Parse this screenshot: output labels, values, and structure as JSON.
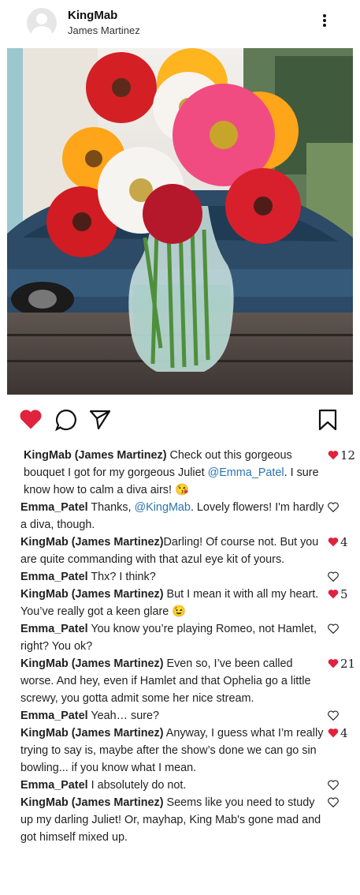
{
  "post": {
    "account_name": "KingMab",
    "real_name": "James Martinez"
  },
  "icons": {
    "avatar": "default-avatar-icon",
    "more": "more-vertical-icon",
    "like": "heart-icon",
    "comment": "comment-icon",
    "share": "send-icon",
    "save": "bookmark-icon"
  },
  "colors": {
    "like_red": "#e0223c",
    "mention_blue": "#2a74b3"
  },
  "comments": [
    {
      "user": "KingMab (James Martinez)",
      "pre": " Check out this gorgeous bouquet I got for my gorgeous Juliet ",
      "mention": "@Emma_Patel",
      "post": ". I sure know how to calm a diva airs! 😘",
      "likes": "12",
      "liked": true
    },
    {
      "user": "Emma_Patel",
      "pre": " Thanks, ",
      "mention": "@KingMab",
      "post": ". Lovely flowers! I'm hardly a diva, though.",
      "likes": "",
      "liked": false
    },
    {
      "user": "KingMab (James Martinez)",
      "pre": "Darling! Of course not. But you are quite commanding with that azul eye kit of yours.",
      "mention": "",
      "post": "",
      "likes": "4",
      "liked": true
    },
    {
      "user": "Emma_Patel",
      "pre": " Thx? I think?",
      "mention": "",
      "post": "",
      "likes": "",
      "liked": false
    },
    {
      "user": "KingMab (James Martinez)",
      "pre": " But I mean it with all my heart. You’ve really got a keen glare 😉",
      "mention": "",
      "post": "",
      "likes": "5",
      "liked": true
    },
    {
      "user": "Emma_Patel",
      "pre": " You know you’re playing Romeo, not Hamlet, right? You ok?",
      "mention": "",
      "post": "",
      "likes": "",
      "liked": false
    },
    {
      "user": "KingMab (James Martinez)",
      "pre": " Even so, I’ve been called worse. And hey, even if Hamlet and that Ophelia go a little screwy, you gotta admit some her nice stream.",
      "mention": "",
      "post": "",
      "likes": "21",
      "liked": true
    },
    {
      "user": "Emma_Patel",
      "pre": " Yeah… sure?",
      "mention": "",
      "post": "",
      "likes": "",
      "liked": false
    },
    {
      "user": "KingMab (James Martinez)",
      "pre": " Anyway, I guess what I’m really trying to say is, maybe after the show’s done we can go sin bowling... if you know what I mean.",
      "mention": "",
      "post": "",
      "likes": "4",
      "liked": true
    },
    {
      "user": "Emma_Patel",
      "pre": " I absolutely do not.",
      "mention": "",
      "post": "",
      "likes": "",
      "liked": false
    },
    {
      "user": "KingMab (James Martinez)",
      "pre": " Seems like you need to study up my darling Juliet! Or, mayhap, King Mab's gone mad and got himself mixed up.",
      "mention": "",
      "post": "",
      "likes": "",
      "liked": false
    }
  ]
}
